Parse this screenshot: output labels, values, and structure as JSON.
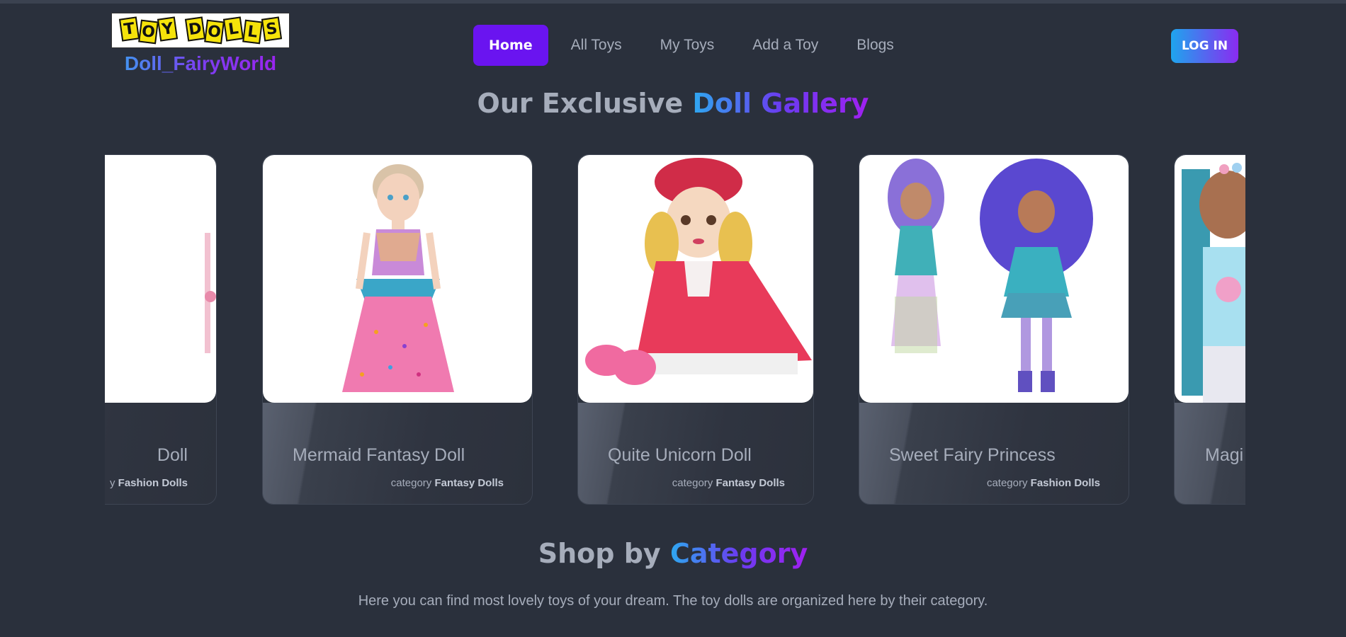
{
  "brand": {
    "logo_letters": [
      "T",
      "O",
      "Y",
      "D",
      "O",
      "L",
      "L",
      "S"
    ],
    "logo_text": "TOY DOLLS",
    "name": "Doll_FairyWorld"
  },
  "nav": {
    "items": [
      {
        "label": "Home",
        "active": true
      },
      {
        "label": "All Toys",
        "active": false
      },
      {
        "label": "My Toys",
        "active": false
      },
      {
        "label": "Add a Toy",
        "active": false
      },
      {
        "label": "Blogs",
        "active": false
      }
    ],
    "login_label": "LOG IN"
  },
  "gallery": {
    "heading_plain": "Our Exclusive",
    "heading_accent": "Doll Gallery",
    "cards": [
      {
        "title": "Doll",
        "category_label": "y",
        "category": "Fashion Dolls"
      },
      {
        "title": "Mermaid Fantasy Doll",
        "category_label": "category",
        "category": "Fantasy Dolls"
      },
      {
        "title": "Quite Unicorn Doll",
        "category_label": "category",
        "category": "Fantasy Dolls"
      },
      {
        "title": "Sweet Fairy Princess",
        "category_label": "category",
        "category": "Fashion Dolls"
      },
      {
        "title": "Magi",
        "category_label": "",
        "category": ""
      }
    ]
  },
  "category_section": {
    "heading_plain": "Shop by",
    "heading_accent": "Category",
    "description": "Here you can find most lovely toys of your dream. The toy dolls are organized here by their category."
  },
  "colors": {
    "background": "#2a303c",
    "primary": "#6a14f0",
    "accent_gradient_start": "#2ea8f0",
    "accent_gradient_end": "#a020f0"
  }
}
